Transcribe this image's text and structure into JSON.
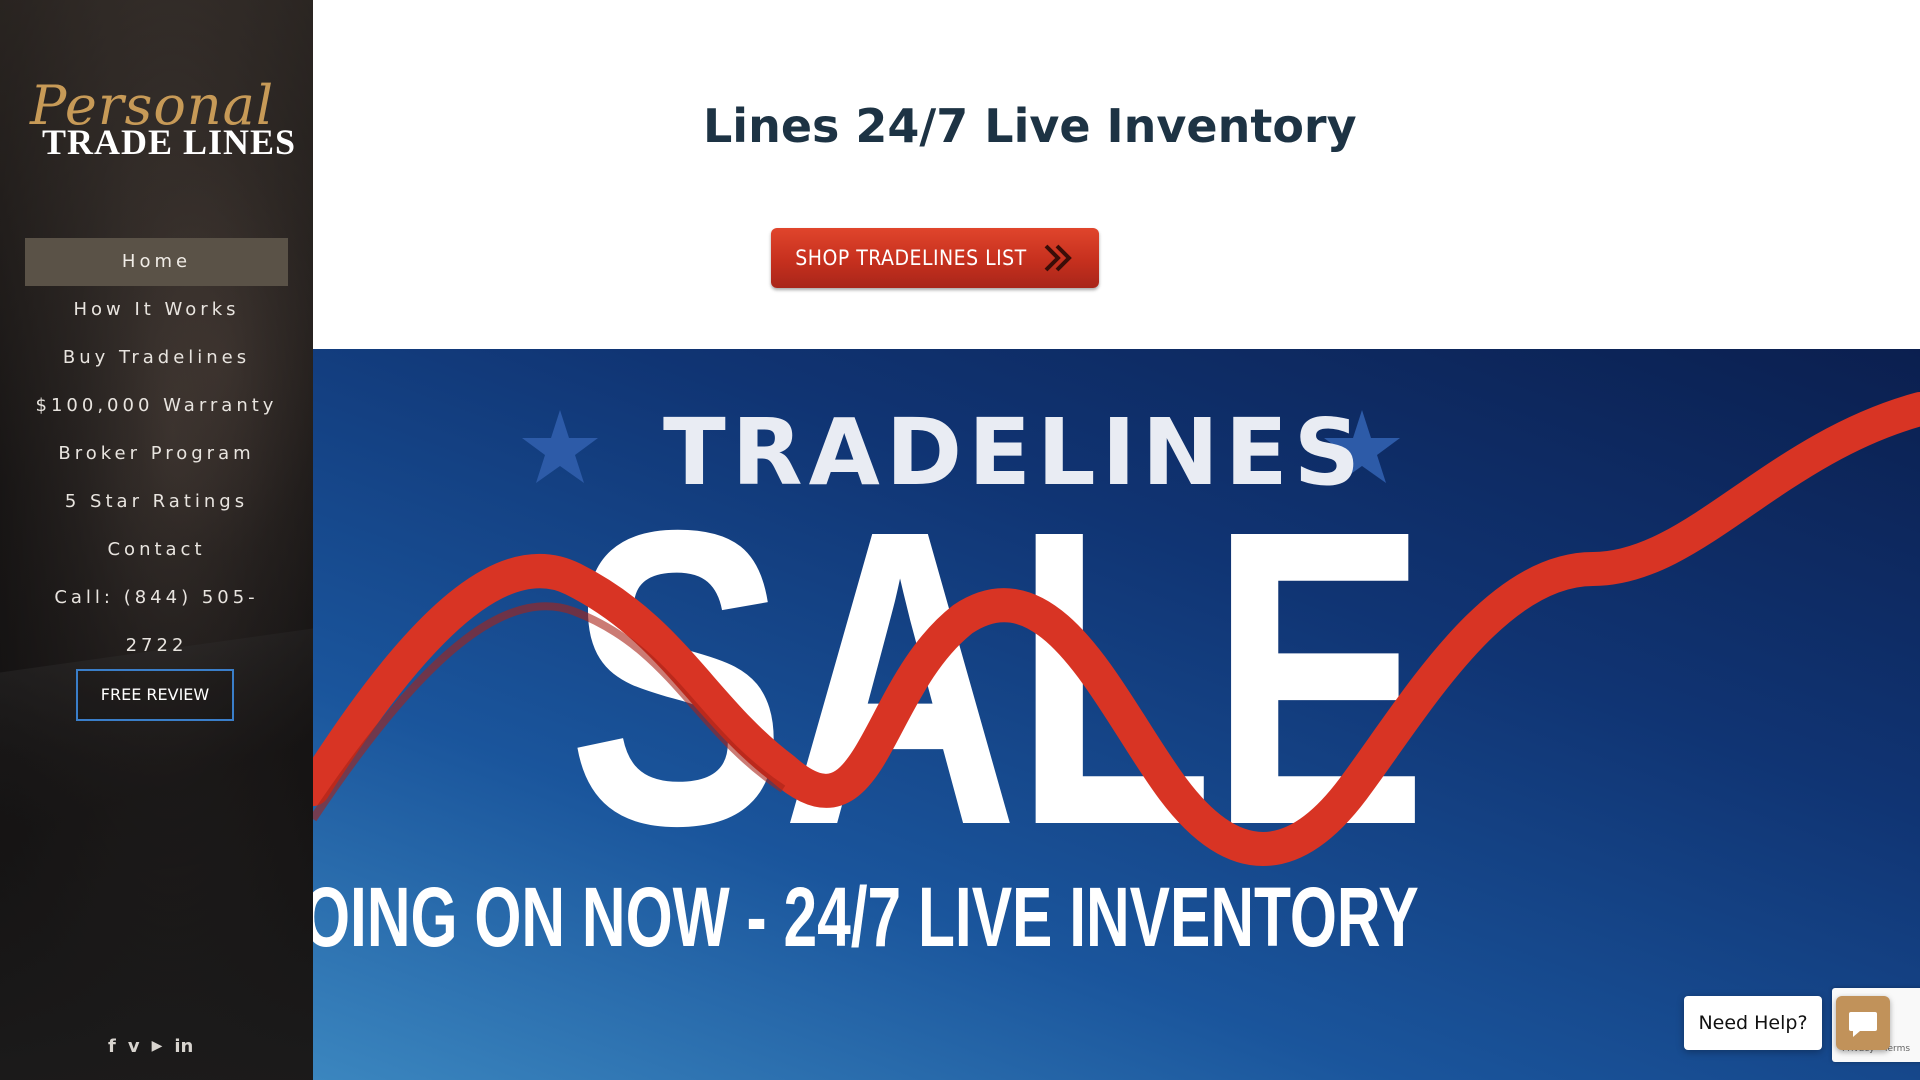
{
  "sidebar": {
    "logo": {
      "script": "Personal",
      "block": "TRADE LINES"
    },
    "nav": [
      {
        "label": "Home",
        "active": true
      },
      {
        "label": "How It Works"
      },
      {
        "label": "Buy Tradelines"
      },
      {
        "label": "$100,000 Warranty"
      },
      {
        "label": "Broker Program"
      },
      {
        "label": "5 Star Ratings"
      },
      {
        "label": "Contact"
      },
      {
        "label": "Call: (844) 505-2722"
      }
    ],
    "cta_label": "FREE REVIEW",
    "social_icons": [
      "facebook-icon",
      "vimeo-icon",
      "youtube-icon",
      "linkedin-icon"
    ],
    "social_glyphs": [
      "f",
      "v",
      "▶",
      "in"
    ]
  },
  "main": {
    "title": "Lines 24/7 Live Inventory",
    "shop_button_label": "SHOP TRADELINES LIST",
    "banner": {
      "heading": "TRADELINES",
      "big_word": "SALE",
      "tagline": "OING ON NOW - 24/7 LIVE INVENTORY"
    }
  },
  "chat": {
    "need_help_label": "Need Help?",
    "recaptcha_text": "Privacy - Terms"
  },
  "colors": {
    "accent_red": "#c6301e",
    "title_navy": "#1d3344",
    "nav_active": "#5a5247",
    "cta_border": "#3a7ec9",
    "chat_button": "#c1925a"
  }
}
